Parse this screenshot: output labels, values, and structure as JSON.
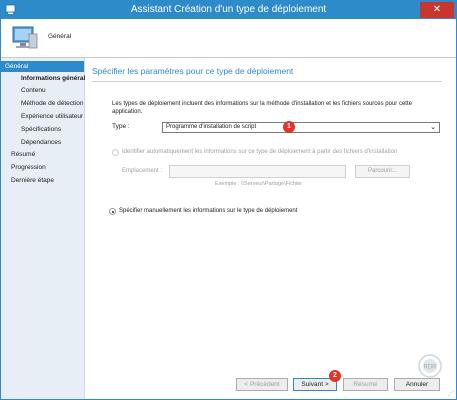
{
  "window": {
    "title": "Assistant Création d'un type de déploiement",
    "close_glyph": "✕"
  },
  "header": {
    "title": "Général",
    "icon": "computer-wizard-icon"
  },
  "sidebar": {
    "items": [
      {
        "label": "Général"
      },
      {
        "label": "Informations générales"
      },
      {
        "label": "Contenu"
      },
      {
        "label": "Méthode de détection"
      },
      {
        "label": "Expérience utilisateur"
      },
      {
        "label": "Spécifications"
      },
      {
        "label": "Dépendances"
      },
      {
        "label": "Résumé"
      },
      {
        "label": "Progression"
      },
      {
        "label": "Dernière étape"
      }
    ]
  },
  "main": {
    "title": "Spécifier les paramètres pour ce type de déploiement",
    "description": "Les types de déploiement incluent des informations sur la méthode d'installation et les fichiers sources pour cette application.",
    "type_label": "Type :",
    "type_value": "Programme d'installation de script",
    "auto_option": "Identifier automatiquement les informations sur ce type de déploiement à partir des fichiers d'installation",
    "location_label": "Emplacement :",
    "location_value": "",
    "browse_label": "Parcourir...",
    "example_text": "Exemple : \\\\Serveur\\Partage\\Fichier",
    "manual_option": "Spécifier manuellement les informations sur le type de déploiement",
    "selected_option": "manual"
  },
  "annotations": {
    "badge1": "1",
    "badge2": "2"
  },
  "footer": {
    "prev_label": "< Précédent",
    "next_label": "Suivant >",
    "summary_label": "Résumé",
    "cancel_label": "Annuler"
  },
  "watermark": "RDR",
  "colors": {
    "accent": "#2e8bc9",
    "close": "#c7372f",
    "badge": "#e2342b"
  }
}
